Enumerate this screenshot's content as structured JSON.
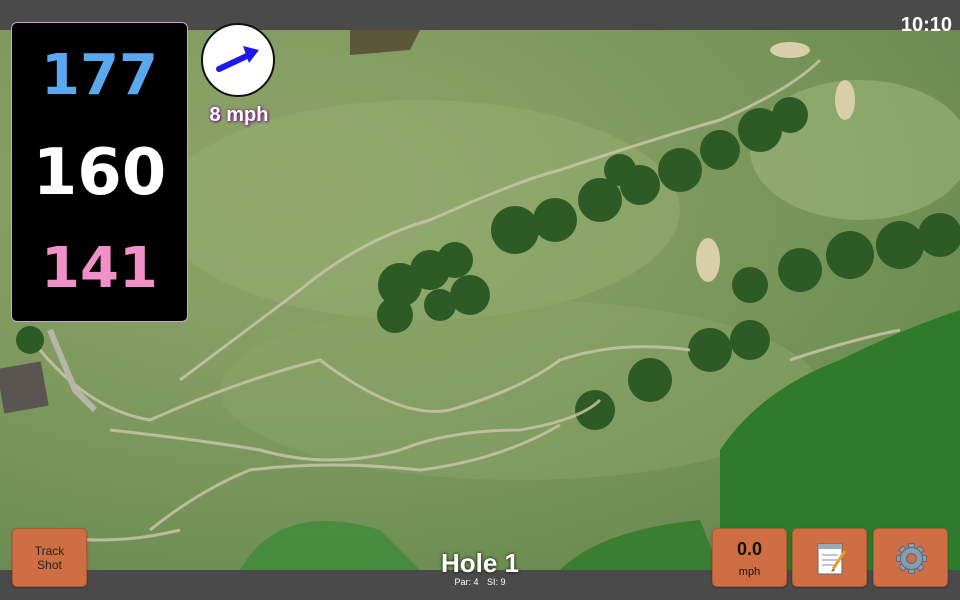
{
  "status": {
    "time": "10:10"
  },
  "distances": {
    "back": "177",
    "middle": "160",
    "front": "141"
  },
  "wind": {
    "speed": "8 mph",
    "arrow_icon": "wind-arrow-icon"
  },
  "buttons": {
    "track_shot_line1": "Track",
    "track_shot_line2": "Shot",
    "speed_value": "0.0",
    "speed_unit": "mph",
    "notes_icon": "notepad-icon",
    "settings_icon": "gear-icon"
  },
  "hole": {
    "title": "Hole 1",
    "par": "Par: 4",
    "si": "SI: 9"
  },
  "colors": {
    "back": "#5aa8f0",
    "middle": "#ffffff",
    "front": "#f08fc8",
    "button": "#cf6e42",
    "wind_arrow": "#1a1aee"
  }
}
